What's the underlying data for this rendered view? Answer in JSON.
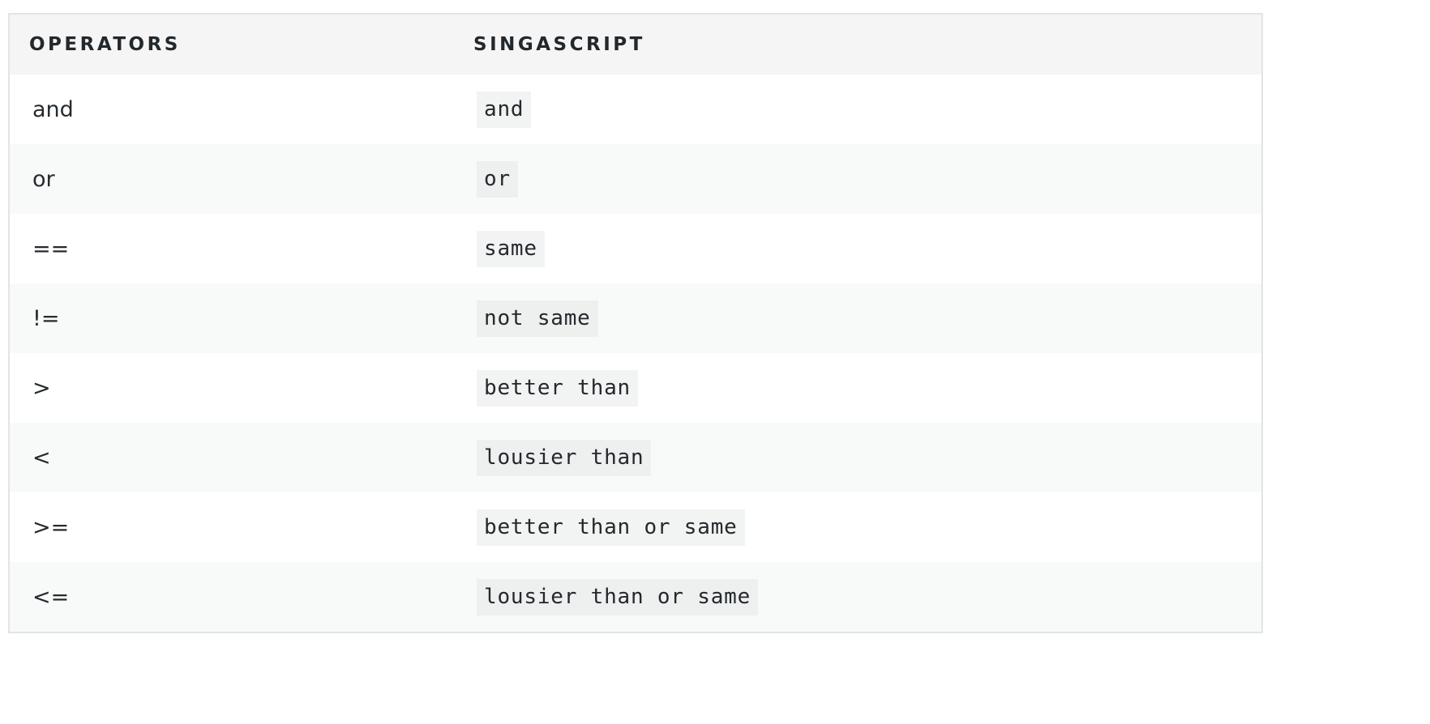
{
  "table": {
    "headers": {
      "operators": "OPERATORS",
      "singascript": "SINGASCRIPT"
    },
    "rows": [
      {
        "operator": "and",
        "singascript": "and"
      },
      {
        "operator": "or",
        "singascript": "or"
      },
      {
        "operator": "==",
        "singascript": "same"
      },
      {
        "operator": "!=",
        "singascript": "not same"
      },
      {
        "operator": ">",
        "singascript": "better than"
      },
      {
        "operator": "<",
        "singascript": "lousier than"
      },
      {
        "operator": ">=",
        "singascript": "better than or same"
      },
      {
        "operator": "<=",
        "singascript": "lousier than or same"
      }
    ]
  }
}
